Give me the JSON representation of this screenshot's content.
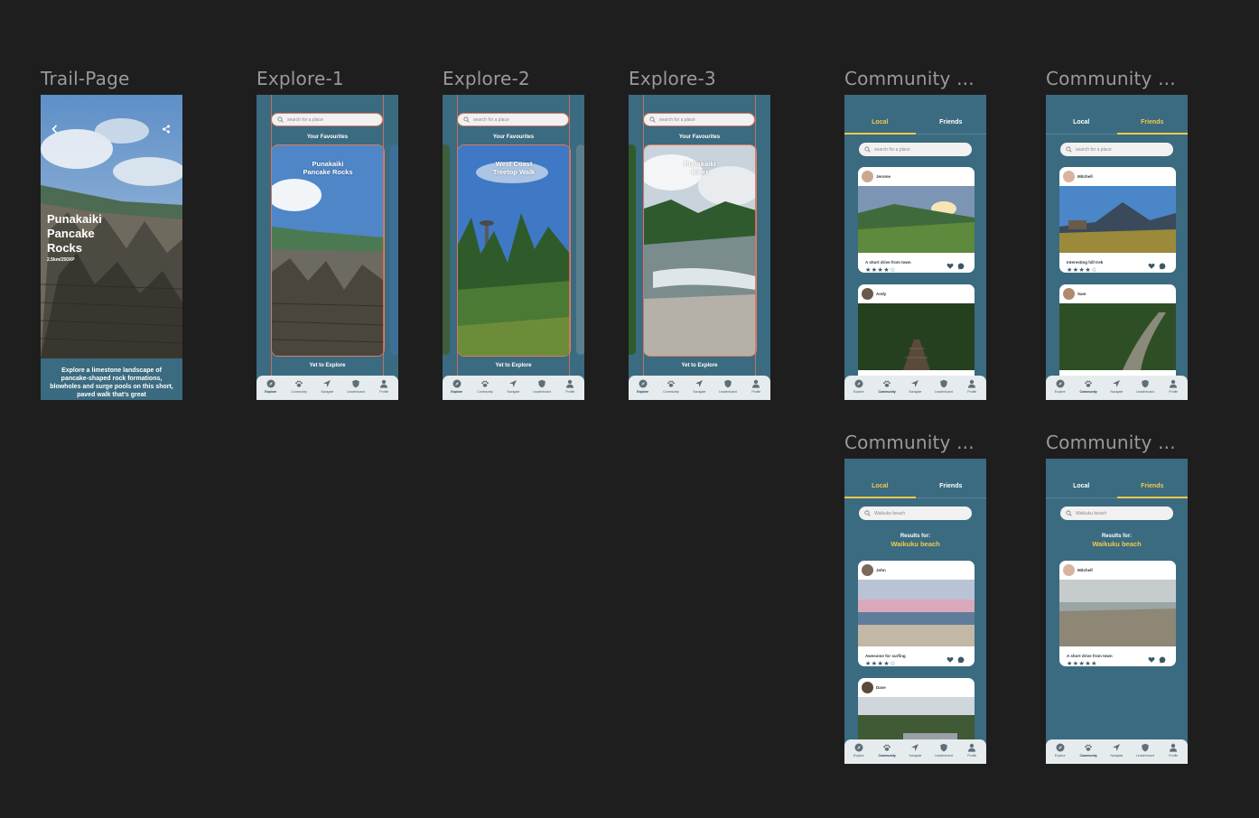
{
  "frames": {
    "trail": {
      "label": "Trail-Page"
    },
    "explore1": {
      "label": "Explore-1"
    },
    "explore2": {
      "label": "Explore-2"
    },
    "explore3": {
      "label": "Explore-3"
    },
    "community1": {
      "label": "Community ..."
    },
    "community2": {
      "label": "Community ..."
    },
    "community3": {
      "label": "Community ..."
    },
    "community4": {
      "label": "Community ..."
    }
  },
  "trail_page": {
    "title_line1": "Punakaiki",
    "title_line2": "Pancake",
    "title_line3": "Rocks",
    "stats": "2.5km/250XP",
    "description": "Explore a limestone landscape of pancake-shaped rock formations, blowholes and surge pools on this short, paved walk that's great"
  },
  "explore": {
    "search_placeholder": "search for a place",
    "favourites_title": "Your Favourites",
    "yet_to_explore": "Yet to Explore",
    "cards": [
      {
        "line1": "Punakaiki",
        "line2": "Pancake Rocks"
      },
      {
        "line1": "West Coast",
        "line2": "Treetop Walk"
      },
      {
        "line1": "Punakaiki",
        "line2": "River"
      }
    ]
  },
  "nav": {
    "explore": "Explore",
    "community": "Community",
    "navigate": "Navigate",
    "leaderboard": "Leaderboard",
    "profile": "Profile"
  },
  "community": {
    "tab_local": "Local",
    "tab_friends": "Friends",
    "search_placeholder": "search for a place",
    "search_value": "Waikuku beach",
    "results_for": "Results for:",
    "results_place": "Waikuku beach",
    "local_posts": [
      {
        "user": "Jerome",
        "caption": "A short drive from town",
        "rating": "★★★★☆"
      },
      {
        "user": "Andy"
      }
    ],
    "friend_posts": [
      {
        "user": "Mitchell",
        "caption": "Interesting hill trek",
        "rating": "★★★★☆"
      },
      {
        "user": "Sam"
      }
    ],
    "local_results": [
      {
        "user": "John",
        "caption": "Awesome for surfing",
        "rating": "★★★★☆"
      },
      {
        "user": "Dave"
      }
    ],
    "friend_results": [
      {
        "user": "Mitchell",
        "caption": "A short drive from town",
        "rating": "★★★★★"
      }
    ]
  },
  "colors": {
    "canvas": "#1e1e1e",
    "phone_bg": "#3b6b80",
    "accent": "#f2c94c",
    "nav_bg": "#e6ebee"
  }
}
